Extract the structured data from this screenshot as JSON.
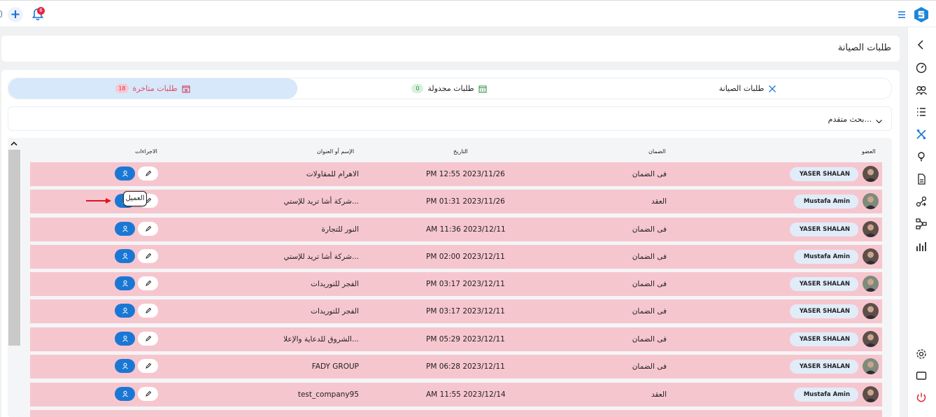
{
  "header": {
    "notification_count": "6"
  },
  "page": {
    "title": "طلبات الصيانة"
  },
  "tabs": [
    {
      "label": "طلبات متاخرة",
      "count": "18",
      "active": true
    },
    {
      "label": "طلبات مجدولة",
      "count": "0",
      "active": false
    },
    {
      "label": "طلبات الصيانة",
      "count": "",
      "active": false
    }
  ],
  "search": {
    "label": "بحث متقدم..."
  },
  "table": {
    "columns": {
      "member": "العضو",
      "guarantee": "الضمان",
      "date": "التاريخ",
      "name": "الإسم أو العنوان",
      "actions": "الاجراءات"
    },
    "rows": [
      {
        "member": "YASER SHALAN",
        "guarantee": "فى الضمان",
        "date": "PM 12:55 2023/11/26",
        "name": "الاهرام للمقاولات"
      },
      {
        "member": "Mustafa Amin",
        "guarantee": "العقد",
        "date": "PM 01:31 2023/11/26",
        "name": "شركة أشا تريد للإستي..."
      },
      {
        "member": "YASER SHALAN",
        "guarantee": "فى الضمان",
        "date": "AM 11:36 2023/12/11",
        "name": "النور للتجارة"
      },
      {
        "member": "Mustafa Amin",
        "guarantee": "فى الضمان",
        "date": "PM 02:00 2023/12/11",
        "name": "شركة أشا تريد للإستي..."
      },
      {
        "member": "YASER SHALAN",
        "guarantee": "فى الضمان",
        "date": "PM 03:17 2023/12/11",
        "name": "الفجر للتوريدات"
      },
      {
        "member": "YASER SHALAN",
        "guarantee": "فى الضمان",
        "date": "PM 03:17 2023/12/11",
        "name": "الفجر للتوريدات"
      },
      {
        "member": "YASER SHALAN",
        "guarantee": "فى الضمان",
        "date": "PM 05:29 2023/12/11",
        "name": "الشروق للدعاية والإعلا..."
      },
      {
        "member": "YASER SHALAN",
        "guarantee": "فى الضمان",
        "date": "PM 06:28 2023/12/11",
        "name": "FADY GROUP"
      },
      {
        "member": "Mustafa Amin",
        "guarantee": "العقد",
        "date": "AM 11:55 2023/12/14",
        "name": "test_company95"
      }
    ]
  },
  "tooltip": {
    "text": "العميل"
  },
  "colors": {
    "accent": "#1a78d4",
    "row_bg": "#f6c6cf",
    "active_tab_bg": "#d6e8fa"
  }
}
